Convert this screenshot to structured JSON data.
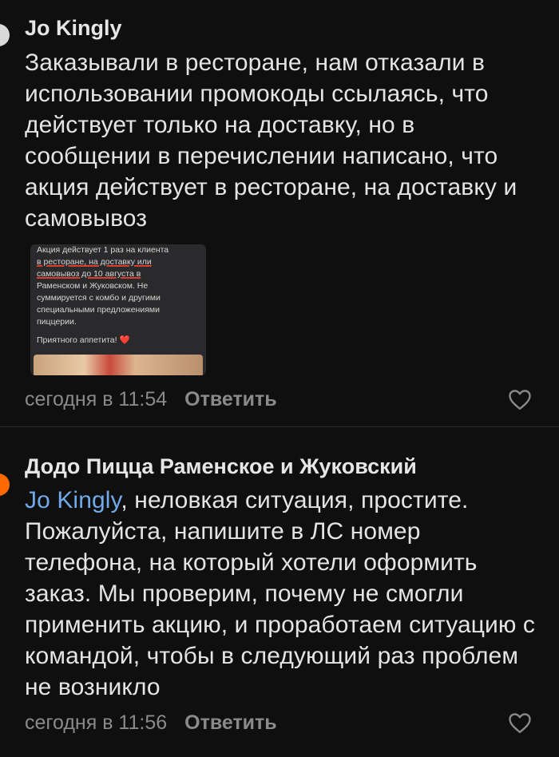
{
  "comments": [
    {
      "author": "Jo Kingly",
      "text": "Заказывали в ресторане, нам отказали в использовании промокоды ссылаясь, что действует только на доставку, но в сообщении в перечислении написано, что акция действует в ресторане, на доставку и самовывоз",
      "attachment": {
        "line1": "Акция действует 1 раз на клиента",
        "line2": "в ресторане, на доставку или",
        "line3": "самовывоз до 10 августа в",
        "line4": "Раменском и Жуковском. Не",
        "line5": "суммируется с комбо и другими",
        "line6": "специальными предложениями",
        "line7": "пиццерии.",
        "line8": "Приятного аппетита! ❤️"
      },
      "timestamp": "сегодня в 11:54",
      "reply_label": "Ответить",
      "avatar_color": "#d9d9d9"
    },
    {
      "author": "Додо Пицца Раменское и Жуковский",
      "mention": "Jo Kingly",
      "text": ", неловкая ситуация, простите. Пожалуйста, напишите в ЛС номер телефона, на который хотели оформить заказ. Мы проверим, почему не смогли применить акцию, и проработаем ситуацию с командой, чтобы в следующий раз проблем не возникло",
      "timestamp": "сегодня в 11:56",
      "reply_label": "Ответить",
      "avatar_color": "#ff6900"
    }
  ],
  "icons": {
    "like": "heart-outline-icon"
  },
  "colors": {
    "background": "#0f0f0f",
    "mention": "#71aaeb",
    "meta": "#8a8a8a",
    "dodo_orange": "#ff6900"
  }
}
